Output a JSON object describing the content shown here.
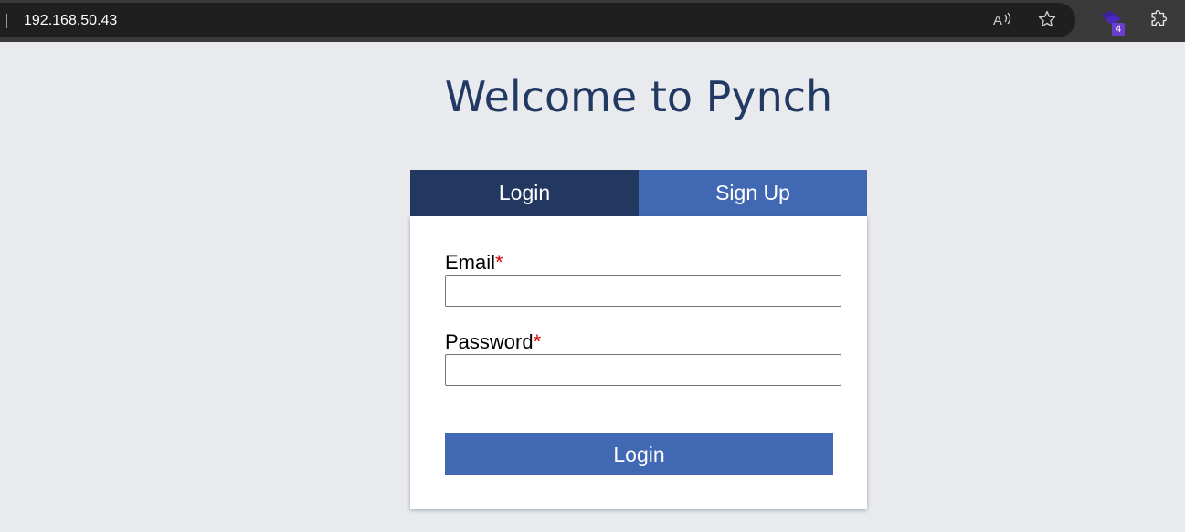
{
  "browser": {
    "address": "192.168.50.43",
    "extension_badge": "4",
    "icons": [
      "read-aloud-icon",
      "favorite-star-icon",
      "extension-icon",
      "extensions-puzzle-icon"
    ]
  },
  "page": {
    "title": "Welcome to Pynch"
  },
  "tabs": [
    {
      "label": "Login",
      "active": true
    },
    {
      "label": "Sign Up",
      "active": false
    }
  ],
  "form": {
    "email_label": "Email",
    "email_value": "",
    "password_label": "Password",
    "password_value": "",
    "required_marker": "*",
    "submit_label": "Login"
  },
  "colors": {
    "background": "#e9eaee",
    "title": "#223a63",
    "active_tab": "#233860",
    "inactive_tab": "#4068b3",
    "button": "#4068b3",
    "required": "#e10000"
  }
}
